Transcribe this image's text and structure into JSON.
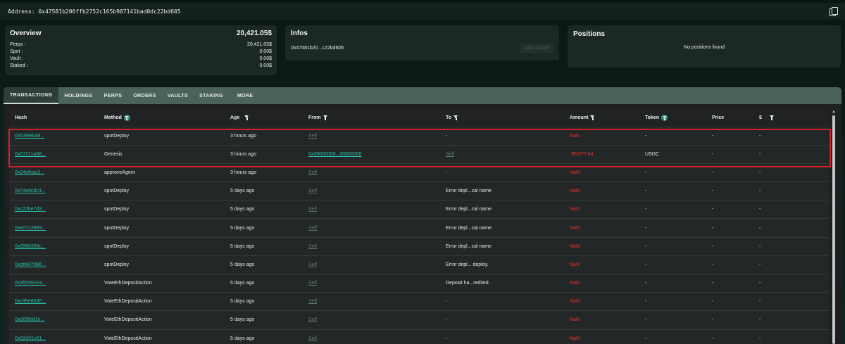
{
  "address_bar": {
    "text": "Address: 0x47581b206ffb2752c165b987141bad0dc22bd605"
  },
  "overview": {
    "title": "Overview",
    "total": "20,421.05$",
    "rows": [
      {
        "label": "Perps :",
        "value": "20,421.05$"
      },
      {
        "label": "Spot :",
        "value": "0.00$"
      },
      {
        "label": "Vault :",
        "value": "0.00$"
      },
      {
        "label": "Staked :",
        "value": "0.00$"
      }
    ]
  },
  "infos": {
    "title": "Infos",
    "address": "0x47581b20...c22bd605",
    "alias_button": "ADD ALIAS"
  },
  "positions": {
    "title": "Positions",
    "empty_text": "No positions found"
  },
  "tabs": [
    "TRANSACTIONS",
    "HOLDINGS",
    "PERPS",
    "ORDERS",
    "VAULTS",
    "STAKING",
    "MORE"
  ],
  "table": {
    "headers": [
      "Hash",
      "Method",
      "Age",
      "From",
      "To",
      "Amount",
      "Token",
      "Price",
      "$"
    ],
    "rows": [
      {
        "hash": "0xfc99eb48...",
        "method": "spotDeploy",
        "age": "3 hours ago",
        "from": "Self",
        "to": "-",
        "amount": "NaN",
        "token": "-",
        "price": "-",
        "usd": "-"
      },
      {
        "hash": "0x67211a56...",
        "method": "Genesis",
        "age": "3 hours ago",
        "from": "0x00000000...00000000",
        "to": "Self",
        "amount": "-39,577.44",
        "token": "USDC",
        "price": "-",
        "usd": "-"
      },
      {
        "hash": "0x24dfeac2...",
        "method": "approveAgent",
        "age": "3 hours ago",
        "from": "Self",
        "to": "-",
        "amount": "NaN",
        "token": "-",
        "price": "-",
        "usd": "-"
      },
      {
        "hash": "0x74e0c8c3...",
        "method": "spotDeploy",
        "age": "5 days ago",
        "from": "Self",
        "to": "Error depl...cal name",
        "amount": "NaN",
        "token": "-",
        "price": "-",
        "usd": "-"
      },
      {
        "hash": "0xc22be7d3...",
        "method": "spotDeploy",
        "age": "5 days ago",
        "from": "Self",
        "to": "Error depl...cal name",
        "amount": "NaN",
        "token": "-",
        "price": "-",
        "usd": "-"
      },
      {
        "hash": "0xe0712869...",
        "method": "spotDeploy",
        "age": "5 days ago",
        "from": "Self",
        "to": "Error depl...cal name",
        "amount": "NaN",
        "token": "-",
        "price": "-",
        "usd": "-"
      },
      {
        "hash": "0x898b336c...",
        "method": "spotDeploy",
        "age": "5 days ago",
        "from": "Self",
        "to": "Error depl...cal name",
        "amount": "NaN",
        "token": "-",
        "price": "-",
        "usd": "-"
      },
      {
        "hash": "0xdd407d86...",
        "method": "spotDeploy",
        "age": "5 days ago",
        "from": "Self",
        "to": "Error depl... deploy.",
        "amount": "NaN",
        "token": "-",
        "price": "-",
        "usd": "-"
      },
      {
        "hash": "0x355561e3...",
        "method": "VoteEthDepositAction",
        "age": "5 days ago",
        "from": "Self",
        "to": "Deposit ha...redited.",
        "amount": "NaN",
        "token": "-",
        "price": "-",
        "usd": "-"
      },
      {
        "hash": "0xc95e8530...",
        "method": "VoteEthDepositAction",
        "age": "5 days ago",
        "from": "Self",
        "to": "-",
        "amount": "NaN",
        "token": "-",
        "price": "-",
        "usd": "-"
      },
      {
        "hash": "0xd05fdd1e...",
        "method": "VoteEthDepositAction",
        "age": "5 days ago",
        "from": "Self",
        "to": "-",
        "amount": "NaN",
        "token": "-",
        "price": "-",
        "usd": "-"
      },
      {
        "hash": "0x82d31c61...",
        "method": "VoteEthDepositAction",
        "age": "5 days ago",
        "from": "Self",
        "to": "-",
        "amount": "NaN",
        "token": "-",
        "price": "-",
        "usd": "-"
      }
    ]
  },
  "colors": {
    "accent_link": "#27c2a8",
    "negative": "#e5382f",
    "highlight_border": "#d51f2a"
  },
  "icons": {
    "copy": "copy-icon",
    "filter": "filter-icon"
  }
}
